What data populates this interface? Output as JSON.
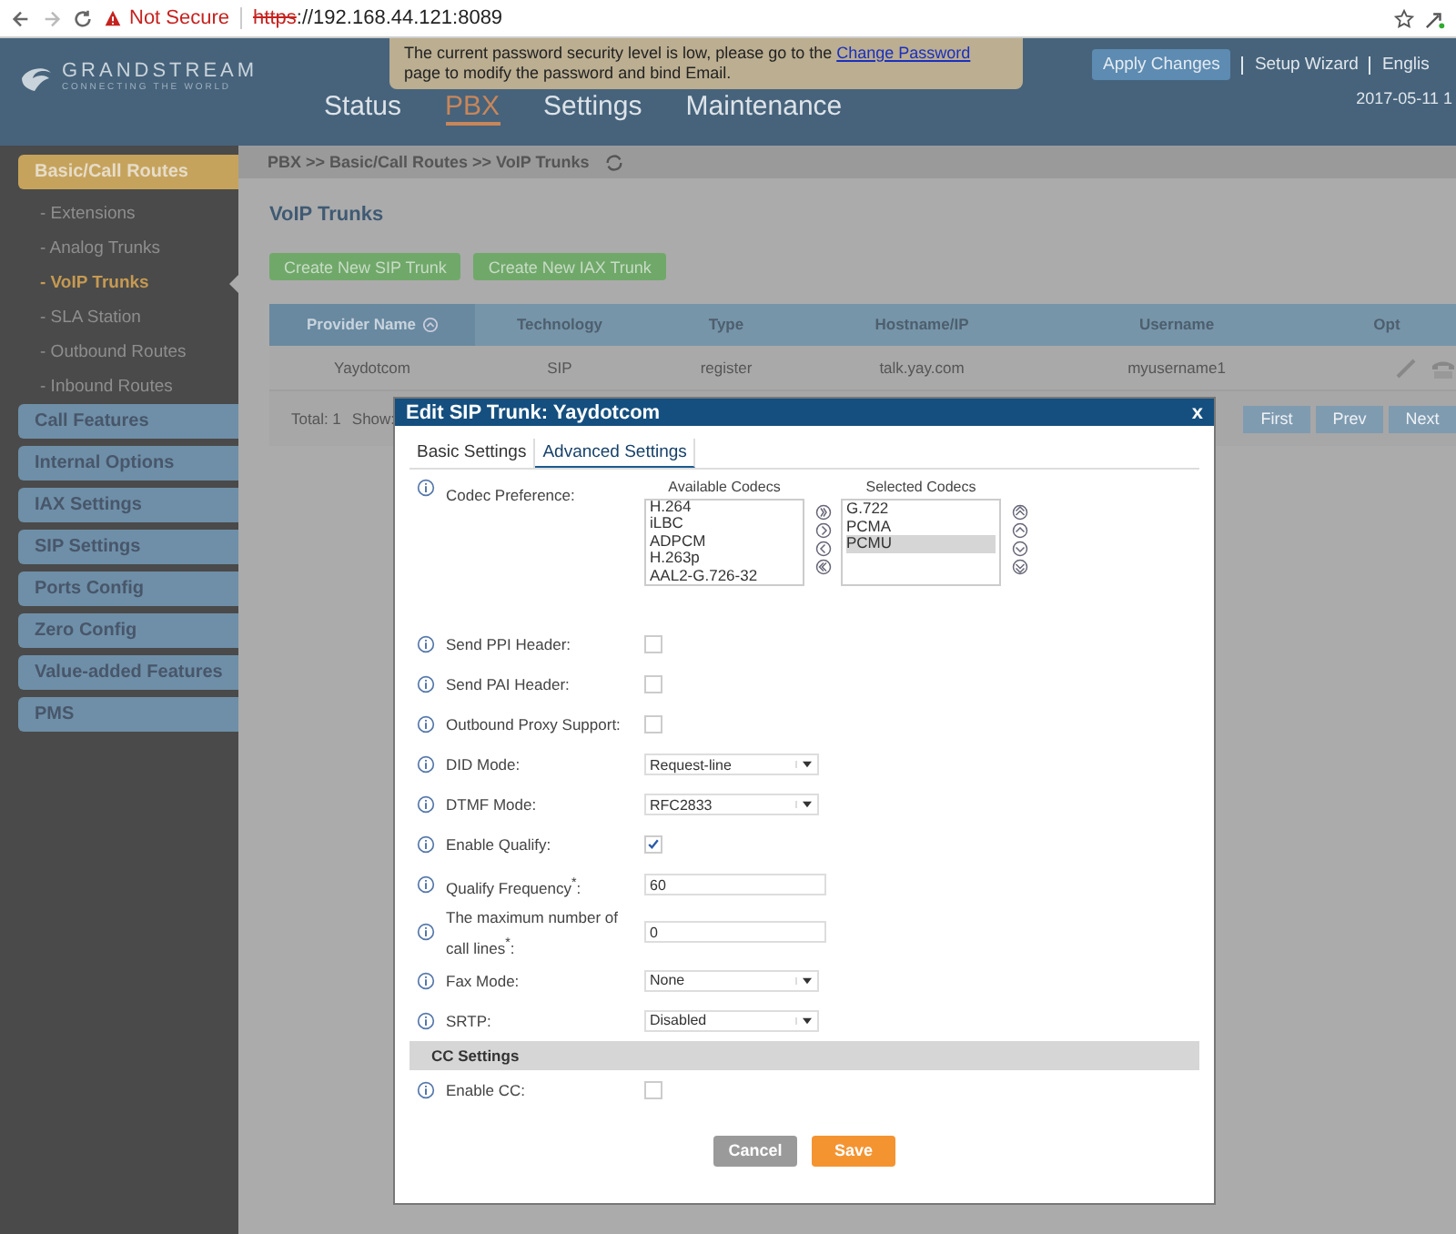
{
  "browser": {
    "security": "Not Secure",
    "scheme": "https",
    "address": "://192.168.44.121:8089"
  },
  "header": {
    "logo": "GRANDSTREAM",
    "tagline": "CONNECTING THE WORLD",
    "notice": {
      "before": "The current password security level is low, please go to the ",
      "link": "Change Password",
      "after": " page to modify the password and bind Email."
    },
    "nav": [
      {
        "label": "Status",
        "selected": false
      },
      {
        "label": "PBX",
        "selected": true
      },
      {
        "label": "Settings",
        "selected": false
      },
      {
        "label": "Maintenance",
        "selected": false
      }
    ],
    "apply_button": "Apply Changes",
    "links": [
      "Setup Wizard",
      "Englis"
    ],
    "date": "2017-05-11 1"
  },
  "breadcrumb": "PBX >> Basic/Call Routes >> VoIP Trunks",
  "sidebar": [
    {
      "label": "Basic/Call Routes",
      "selected": true,
      "children": [
        {
          "label": "- Extensions",
          "selected": false
        },
        {
          "label": "- Analog Trunks",
          "selected": false
        },
        {
          "label": "- VoIP Trunks",
          "selected": true
        },
        {
          "label": "- SLA Station",
          "selected": false
        },
        {
          "label": "- Outbound Routes",
          "selected": false
        },
        {
          "label": "- Inbound Routes",
          "selected": false
        }
      ]
    },
    {
      "label": "Call Features",
      "selected": false
    },
    {
      "label": "Internal Options",
      "selected": false
    },
    {
      "label": "IAX Settings",
      "selected": false
    },
    {
      "label": "SIP Settings",
      "selected": false
    },
    {
      "label": "Ports Config",
      "selected": false
    },
    {
      "label": "Zero Config",
      "selected": false
    },
    {
      "label": "Value-added Features",
      "selected": false
    },
    {
      "label": "PMS",
      "selected": false
    }
  ],
  "page": {
    "title": "VoIP Trunks",
    "buttons": [
      "Create New SIP Trunk",
      "Create New IAX Trunk"
    ],
    "table": {
      "columns": [
        "Provider Name",
        "Technology",
        "Type",
        "Hostname/IP",
        "Username",
        "Opt"
      ],
      "rows": [
        [
          "Yaydotcom",
          "SIP",
          "register",
          "talk.yay.com",
          "myusername1"
        ]
      ]
    },
    "total": "Total: 1",
    "show": "Show:",
    "pager": [
      "First",
      "Prev",
      "Next"
    ]
  },
  "dialog": {
    "title": "Edit SIP Trunk: Yaydotcom",
    "close": "x",
    "tabs": [
      {
        "label": "Basic Settings",
        "selected": false
      },
      {
        "label": "Advanced Settings",
        "selected": true
      }
    ],
    "codec": {
      "label": "Codec Preference:",
      "available_title": "Available Codecs",
      "selected_title": "Selected Codecs",
      "available": [
        "H.264",
        "iLBC",
        "ADPCM",
        "H.263p",
        "AAL2-G.726-32"
      ],
      "selected": [
        {
          "label": "G.722",
          "selected": false
        },
        {
          "label": "PCMA",
          "selected": false
        },
        {
          "label": "PCMU",
          "selected": true
        }
      ]
    },
    "fields": [
      {
        "kind": "checkbox",
        "label": "Send PPI Header:",
        "checked": false
      },
      {
        "kind": "checkbox",
        "label": "Send PAI Header:",
        "checked": false
      },
      {
        "kind": "checkbox",
        "label": "Outbound Proxy Support:",
        "checked": false
      },
      {
        "kind": "select",
        "label": "DID Mode:",
        "value": "Request-line"
      },
      {
        "kind": "select",
        "label": "DTMF Mode:",
        "value": "RFC2833"
      },
      {
        "kind": "checkbox",
        "label": "Enable Qualify:",
        "checked": true
      },
      {
        "kind": "text",
        "label": "Qualify Frequency$^{*}$:",
        "value": "60"
      },
      {
        "kind": "text",
        "label": "The maximum number of call lines$^{*}$:",
        "value": "0"
      },
      {
        "kind": "select",
        "label": "Fax Mode:",
        "value": "None"
      },
      {
        "kind": "select",
        "label": "SRTP:",
        "value": "Disabled"
      }
    ],
    "section": "CC Settings",
    "cc_fields": [
      {
        "kind": "checkbox",
        "label": "Enable CC:",
        "checked": false
      }
    ],
    "buttons": [
      "Cancel",
      "Save"
    ]
  }
}
